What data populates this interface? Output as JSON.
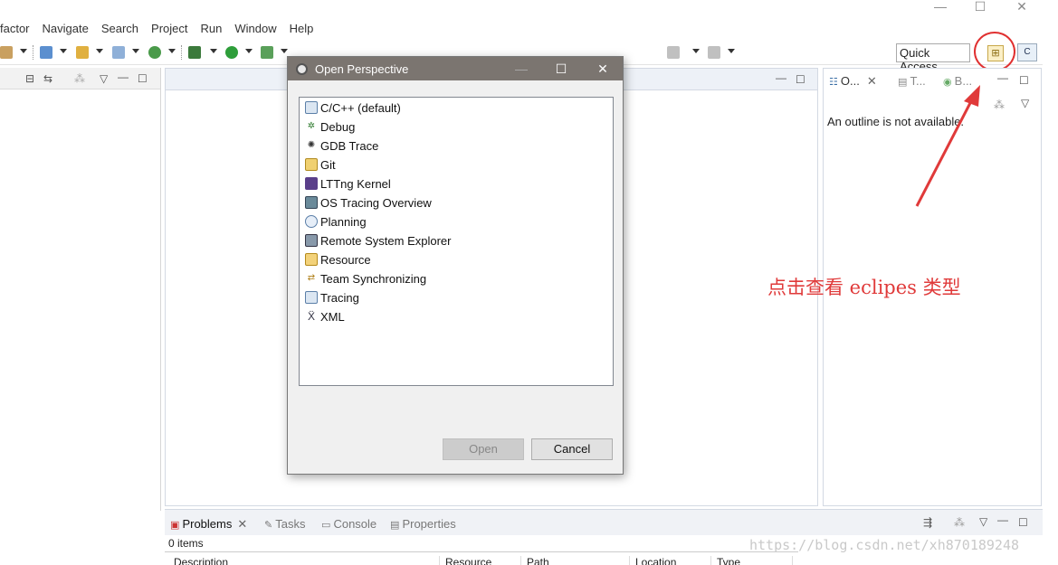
{
  "menubar": {
    "items": [
      "factor",
      "Navigate",
      "Search",
      "Project",
      "Run",
      "Window",
      "Help"
    ]
  },
  "window_controls": {
    "minimize": "—",
    "maximize": "☐",
    "close": "✕"
  },
  "toolbar": {
    "quick_access": "Quick Access",
    "open_perspective_icon": "open-perspective-icon",
    "cdt_perspective_icon": "cdt-perspective-icon"
  },
  "right_view": {
    "tabs": [
      "O...",
      "T...",
      "B..."
    ],
    "outline_message": "An outline is not available."
  },
  "dialog": {
    "title": "Open Perspective",
    "perspectives": [
      {
        "label": "C/C++ (default)",
        "icon": "c-cpp-icon"
      },
      {
        "label": "Debug",
        "icon": "bug-icon"
      },
      {
        "label": "GDB Trace",
        "icon": "gdb-trace-icon"
      },
      {
        "label": "Git",
        "icon": "git-icon"
      },
      {
        "label": "LTTng Kernel",
        "icon": "lttng-icon"
      },
      {
        "label": "OS Tracing Overview",
        "icon": "os-tracing-icon"
      },
      {
        "label": "Planning",
        "icon": "planning-icon"
      },
      {
        "label": "Remote System Explorer",
        "icon": "remote-system-icon"
      },
      {
        "label": "Resource",
        "icon": "resource-icon"
      },
      {
        "label": "Team Synchronizing",
        "icon": "team-sync-icon"
      },
      {
        "label": "Tracing",
        "icon": "tracing-icon"
      },
      {
        "label": "XML",
        "icon": "xml-icon"
      }
    ],
    "open_label": "Open",
    "cancel_label": "Cancel"
  },
  "bottom_panel": {
    "tabs": [
      "Problems",
      "Tasks",
      "Console",
      "Properties"
    ],
    "items_count": "0 items",
    "columns": [
      "Description",
      "Resource",
      "Path",
      "Location",
      "Type"
    ]
  },
  "annotation": {
    "text": "点击查看 eclipes 类型",
    "color": "#e03a3a"
  },
  "watermark": "https://blog.csdn.net/xh870189248"
}
